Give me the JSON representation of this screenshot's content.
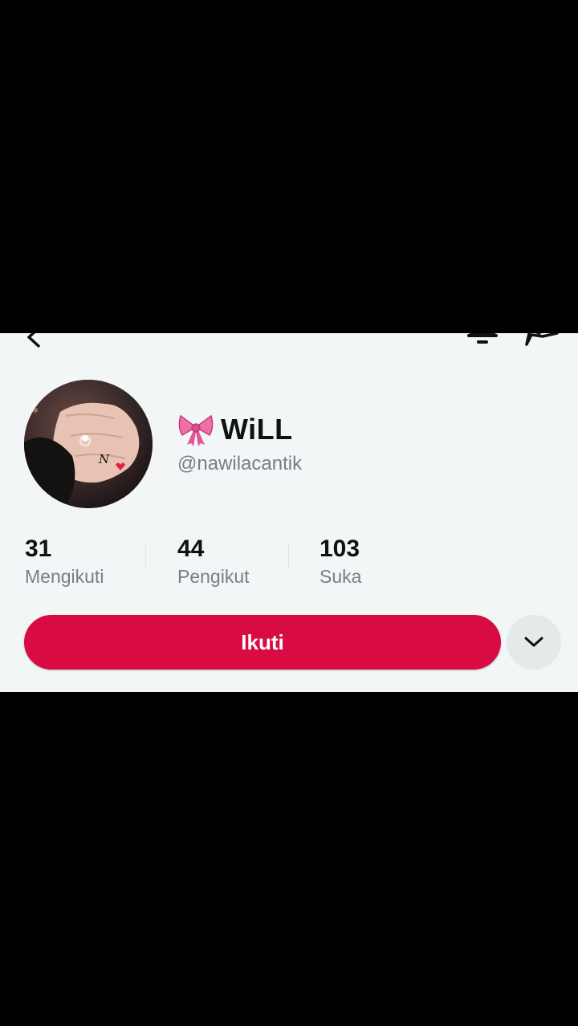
{
  "profile": {
    "display_name": "WiLL",
    "username": "@nawilacantik",
    "avatar_initial": "N"
  },
  "stats": [
    {
      "value": "31",
      "label": "Mengikuti"
    },
    {
      "value": "44",
      "label": "Pengikut"
    },
    {
      "value": "103",
      "label": "Suka"
    }
  ],
  "actions": {
    "follow_label": "Ikuti"
  },
  "icons": {
    "back": "back-arrow-icon",
    "notifications": "bell-icon",
    "share": "share-icon",
    "name_prefix": "ribbon-bow-icon",
    "more": "chevron-down-icon"
  },
  "colors": {
    "accent": "#d80b43",
    "background": "#f2f6f6",
    "secondary_text": "#7a7d82"
  }
}
